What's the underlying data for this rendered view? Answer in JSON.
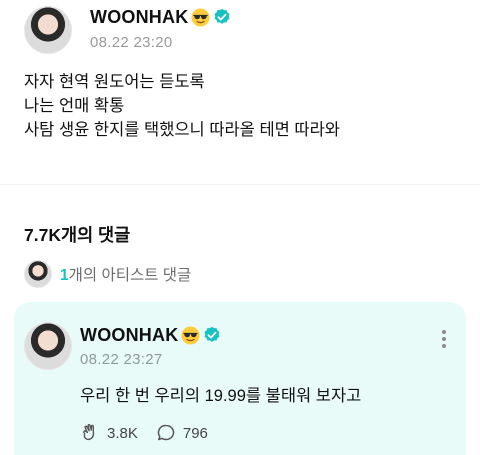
{
  "post": {
    "author": "WOONHAK",
    "timestamp": "08.22 23:20",
    "lines": [
      "자자 현역 원도어는 듣도록",
      "나는 언매 확통",
      "사탐 생윤 한지를 택했으니 따라올 테면 따라와"
    ]
  },
  "comments": {
    "count_label": "7.7K개의 댓글",
    "artist_count": "1",
    "artist_label": "개의 아티스트 댓글"
  },
  "comment": {
    "author": "WOONHAK",
    "timestamp": "08.22 23:27",
    "text": "우리 한 번 우리의 19.99를 불태워 보자고",
    "likes": "3.8K",
    "replies": "796"
  },
  "icons": {
    "emoji": "sunglasses-emoji-icon",
    "verified": "verified-badge-icon",
    "more": "more-vertical-icon",
    "like": "like-hand-icon",
    "reply": "comment-bubble-icon"
  },
  "colors": {
    "verified": "#19c2c2",
    "artist_accent": "#19c2c2",
    "card_background": "#e9fbf8"
  }
}
